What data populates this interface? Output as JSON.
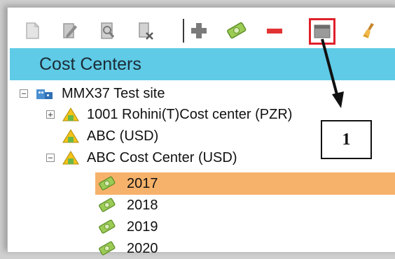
{
  "header": {
    "title": "Cost Centers"
  },
  "toolbar": {
    "buttons": [
      {
        "name": "new-icon",
        "color": "#c8c8c8"
      },
      {
        "name": "edit-icon",
        "color": "#9a9a9a"
      },
      {
        "name": "view-icon",
        "color": "#9a9a9a"
      },
      {
        "name": "delete-document-icon",
        "color": "#9a9a9a"
      },
      {
        "name": "add-icon",
        "color": "#777777"
      },
      {
        "name": "money-icon",
        "color": "#8fc04a"
      },
      {
        "name": "remove-icon",
        "color": "#e23333"
      },
      {
        "name": "calendar-window-icon",
        "color": "#8a8a8a",
        "highlighted": true
      },
      {
        "name": "clean-brush-icon",
        "color": "#e0a030"
      }
    ]
  },
  "tree": {
    "root": {
      "label": "MMX37 Test site",
      "expander": "−"
    },
    "items": [
      {
        "label": "1001 Rohini(T)Cost center (PZR)",
        "expander": "+"
      },
      {
        "label": "ABC (USD)"
      },
      {
        "label": "ABC Cost Center (USD)",
        "expander": "−"
      }
    ],
    "years": [
      {
        "label": "2017",
        "selected": true
      },
      {
        "label": "2018"
      },
      {
        "label": "2019"
      },
      {
        "label": "2020"
      }
    ]
  },
  "annotation": {
    "label": "1"
  },
  "colors": {
    "header": "#5fcbe6",
    "selection": "#f6b26b",
    "highlight": "#e0202a"
  }
}
